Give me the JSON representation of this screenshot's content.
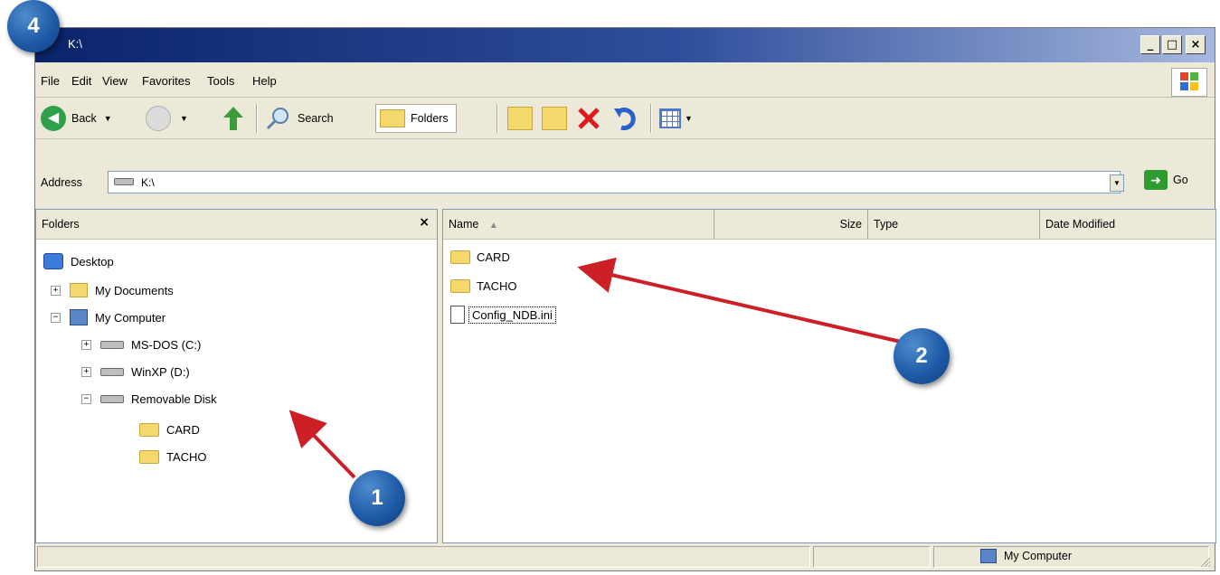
{
  "window": {
    "title": "K:\\"
  },
  "window_controls": {
    "minimize": "_",
    "maximize": "□",
    "close": "×"
  },
  "menu": [
    "File",
    "Edit",
    "View",
    "Favorites",
    "Tools",
    "Help"
  ],
  "toolbar": {
    "back_label": "Back",
    "search_label": "Search",
    "folders_label": "Folders"
  },
  "address": {
    "label": "Address",
    "value": "K:\\",
    "go_label": "Go"
  },
  "folders_pane": {
    "title": "Folders",
    "tree": [
      {
        "label": "Desktop",
        "icon": "desktop-icon"
      },
      {
        "label": "My Documents",
        "icon": "folder-icon"
      },
      {
        "label": "My Computer",
        "icon": "computer-icon"
      },
      {
        "label": "MS-DOS (C:)",
        "icon": "drive-icon"
      },
      {
        "label": "WinXP (D:)",
        "icon": "drive-icon"
      },
      {
        "label": "Removable Disk",
        "icon": "drive-icon"
      },
      {
        "label": "CARD",
        "icon": "folder-icon"
      },
      {
        "label": "TACHO",
        "icon": "folder-icon"
      }
    ]
  },
  "files_pane": {
    "columns": [
      "Name",
      "Size",
      "Type",
      "Date Modified"
    ],
    "items": [
      {
        "name": "CARD",
        "icon": "folder-icon"
      },
      {
        "name": "TACHO",
        "icon": "folder-icon"
      },
      {
        "name": "Config_NDB.ini",
        "icon": "ini-file-icon"
      }
    ]
  },
  "status": {
    "location": "My Computer"
  },
  "annotations": {
    "step_1": "1",
    "step_2": "2",
    "step_4": "4",
    "color": "#1f5ba8",
    "arrow_color": "#cc1f26"
  }
}
